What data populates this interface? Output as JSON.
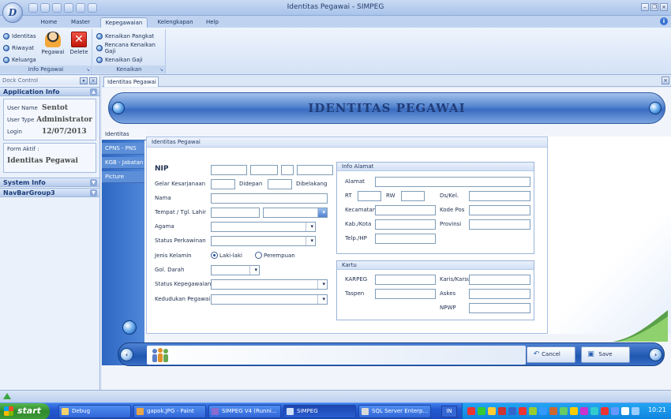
{
  "window": {
    "title": "Identitas Pegawai - SIMPEG",
    "app_logo": "D"
  },
  "ribbon_tabs": [
    "Home",
    "Master",
    "Kepegawaian",
    "Kelengkapan",
    "Help"
  ],
  "ribbon": {
    "info_pegawai": {
      "label": "Info Pegawai",
      "small_buttons": [
        "Identitas",
        "Riwayat",
        "Keluarga"
      ],
      "pegawai_label": "Pegawai",
      "delete_label": "Delete"
    },
    "kenaikan": {
      "label": "Kenaikan",
      "small_buttons": [
        "Kenaikan Pangkat",
        "Rencana Kenaikan Gaji",
        "Kenaikan Gaji"
      ]
    }
  },
  "dock": {
    "title": "Dock Control",
    "application_info_title": "Application Info",
    "user_name_label": "User Name",
    "user_name": "Sentot",
    "user_type_label": "User Type",
    "user_type": "Administrator",
    "login_label": "Login",
    "login_date": "12/07/2013",
    "form_aktif_label": "Form Aktif :",
    "form_aktif_value": "Identitas Pegawai",
    "system_info_title": "System Info",
    "navbar_group3_title": "NavBarGroup3"
  },
  "document_tab": "Identitas Pegawai",
  "banner_title": "IDENTITAS PEGAWAI",
  "side_tabs": [
    "Identitas",
    "CPNS - PNS",
    "KGB - Jabatan",
    "Picture"
  ],
  "form": {
    "panel_title": "Identitas Pegawai",
    "nip_label": "NIP",
    "gelar_label": "Gelar Kesarjanaan",
    "didepan_label": "Didepan",
    "dibelakang_label": "Dibelakang",
    "nama_label": "Nama",
    "ttl_label": "Tempat / Tgl. Lahir",
    "agama_label": "Agama",
    "status_kawin_label": "Status Perkawinan",
    "jenis_kelamin_label": "Jenis Kelamin",
    "laki_label": "Laki-laki",
    "perempuan_label": "Perempuan",
    "gol_darah_label": "Gol. Darah",
    "status_kepegawaian_label": "Status Kepegawaian",
    "kedudukan_label": "Kedudukan Pegawai"
  },
  "alamat": {
    "title": "Info Alamat",
    "alamat_label": "Alamat",
    "rt_label": "RT",
    "rw_label": "RW",
    "ds_kel_label": "Ds/Kel.",
    "kecamatan_label": "Kecamatan",
    "kode_pos_label": "Kode Pos",
    "kab_kota_label": "Kab./Kota",
    "provinsi_label": "Provinsi",
    "telp_label": "Telp./HP"
  },
  "kartu": {
    "title": "Kartu",
    "karpeg_label": "KARPEG",
    "karis_label": "Karis/Karsu",
    "taspen_label": "Taspen",
    "askes_label": "Askes",
    "npwp_label": "NPWP"
  },
  "actions": {
    "cancel_label": "Cancel",
    "save_label": "Save"
  },
  "taskbar": {
    "start_label": "start",
    "tasks": [
      "Debug",
      "gapok.JPG - Paint",
      "SIMPEG V4 (Runni...",
      "SIMPEG",
      "SQL Server Enterp..."
    ],
    "lang": "IN",
    "clock": "10:21"
  },
  "colors": {
    "accent_blue": "#2c66c2",
    "banner_blue": "#3a6cc0",
    "taskbar_blue": "#2459d1",
    "start_green": "#3f9c3a"
  }
}
